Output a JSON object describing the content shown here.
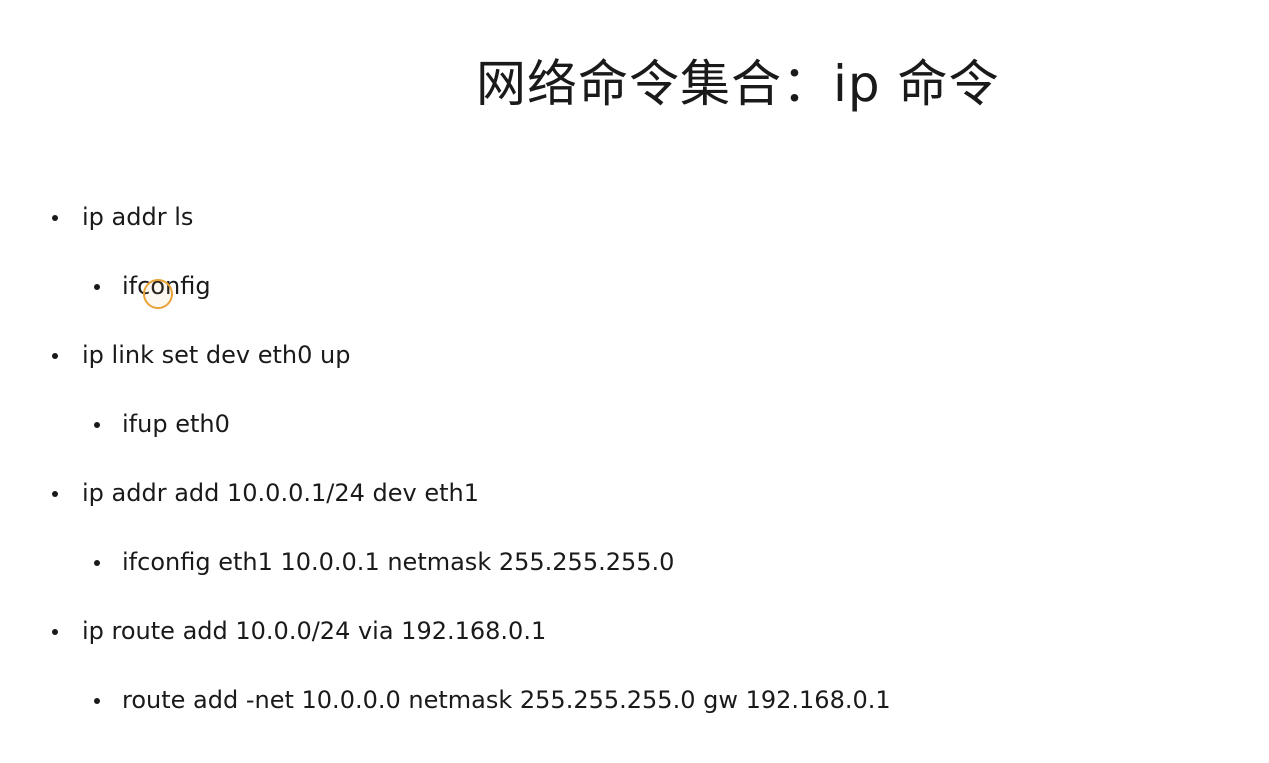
{
  "slide": {
    "title": "网络命令集合：ip 命令",
    "items": [
      {
        "text": "ip addr ls",
        "level": 1
      },
      {
        "text": "ifconfig",
        "level": 2
      },
      {
        "text": "ip link set dev eth0 up",
        "level": 1
      },
      {
        "text": "ifup eth0",
        "level": 2
      },
      {
        "text": "ip addr add 10.0.0.1/24 dev eth1",
        "level": 1
      },
      {
        "text": "ifconfig eth1 10.0.0.1 netmask 255.255.255.0",
        "level": 2
      },
      {
        "text": "ip route add 10.0.0/24 via 192.168.0.1",
        "level": 1
      },
      {
        "text": "route add -net 10.0.0.0 netmask 255.255.255.0  gw 192.168.0.1",
        "level": 2
      }
    ]
  },
  "colors": {
    "text": "#1a1a1a",
    "background": "#ffffff",
    "cursor_highlight": "#e8a33a"
  },
  "icons": {
    "cursor": "mouse-cursor-highlight-icon"
  }
}
